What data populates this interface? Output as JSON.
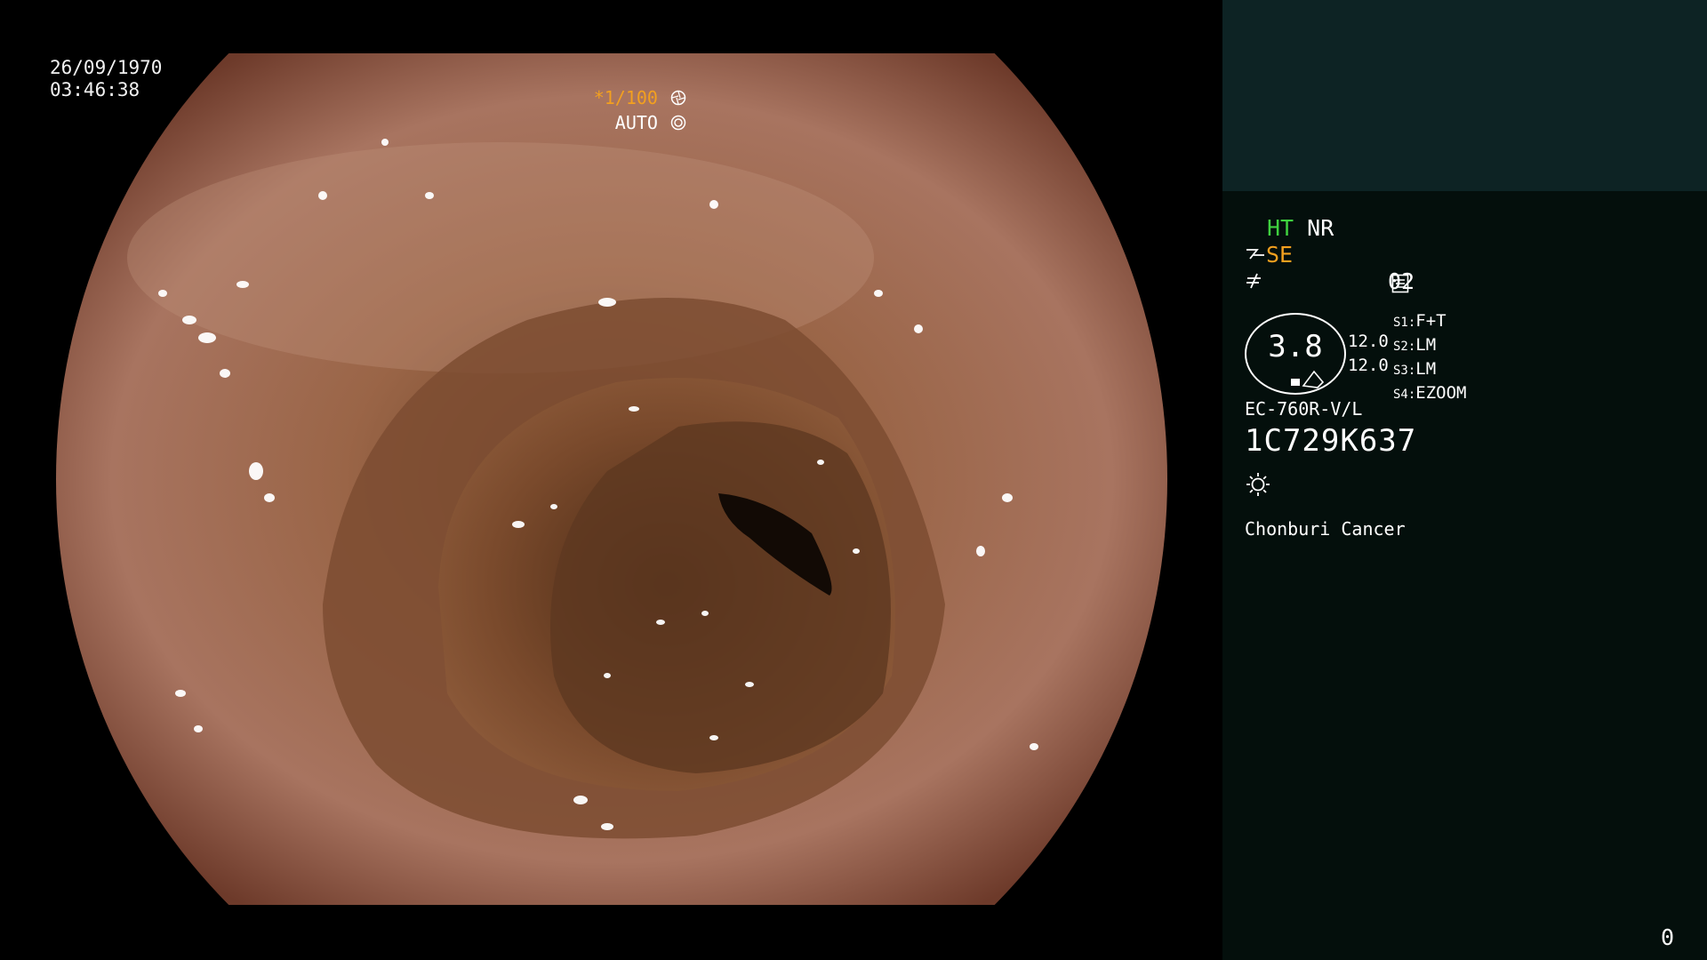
{
  "overlay": {
    "date": "26/09/1970",
    "time": "03:46:38",
    "shutter": "*1/100",
    "iris": "AUTO"
  },
  "status": {
    "ht": "HT",
    "nr": "NR",
    "se": "SE",
    "page": "02",
    "zoom": "3.8",
    "val1": "12.0",
    "val2": "12.0",
    "settings": [
      {
        "key": "S1:",
        "value": "F+T"
      },
      {
        "key": "S2:",
        "value": "LM"
      },
      {
        "key": "S3:",
        "value": "LM"
      },
      {
        "key": "S4:",
        "value": "EZOOM"
      }
    ],
    "model": "EC-760R-V/L",
    "serial": "1C729K637",
    "institution": "Chonburi Cancer",
    "counter": "0"
  },
  "colors": {
    "accent_green": "#3fd13f",
    "accent_orange": "#f3a01f",
    "panel_bg": "#040f0c",
    "thumb_bg": "#0d2324"
  },
  "icons": [
    "shutter-icon",
    "iris-icon",
    "structure-icon",
    "color-enhance-icon",
    "page-icon",
    "light-icon"
  ]
}
